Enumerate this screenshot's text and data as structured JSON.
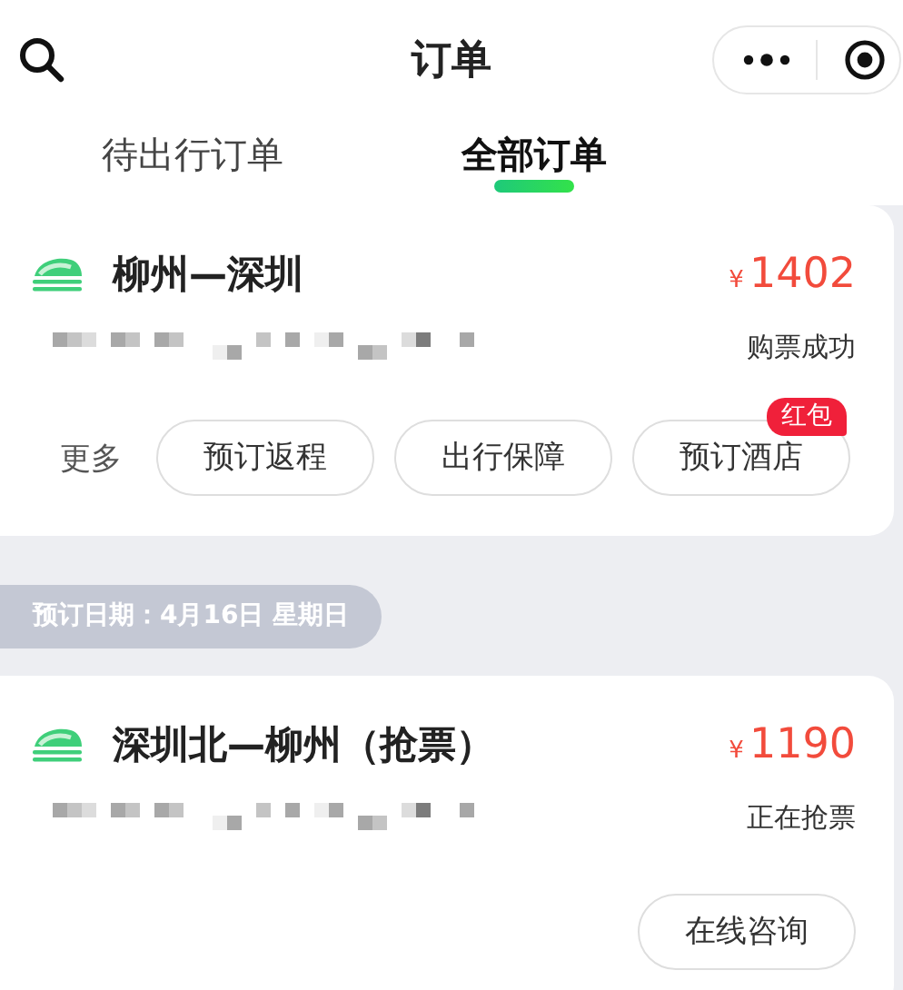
{
  "navbar": {
    "title": "订单"
  },
  "tabs": [
    {
      "label": "待出行订单",
      "selected": false
    },
    {
      "label": "全部订单",
      "selected": true
    }
  ],
  "feed": [
    {
      "kind": "order",
      "route": "柳州—深圳",
      "currency": "¥",
      "price": "1402",
      "status": "购票成功",
      "more_label": "更多",
      "actions": [
        {
          "label": "预订返程"
        },
        {
          "label": "出行保障"
        },
        {
          "label": "预订酒店",
          "badge": "红包"
        }
      ]
    },
    {
      "kind": "date",
      "label": "预订日期：4月16日 星期日"
    },
    {
      "kind": "order",
      "route": "深圳北—柳州（抢票）",
      "currency": "¥",
      "price": "1190",
      "status": "正在抢票",
      "actions": [
        {
          "label": "在线咨询"
        }
      ]
    }
  ]
}
